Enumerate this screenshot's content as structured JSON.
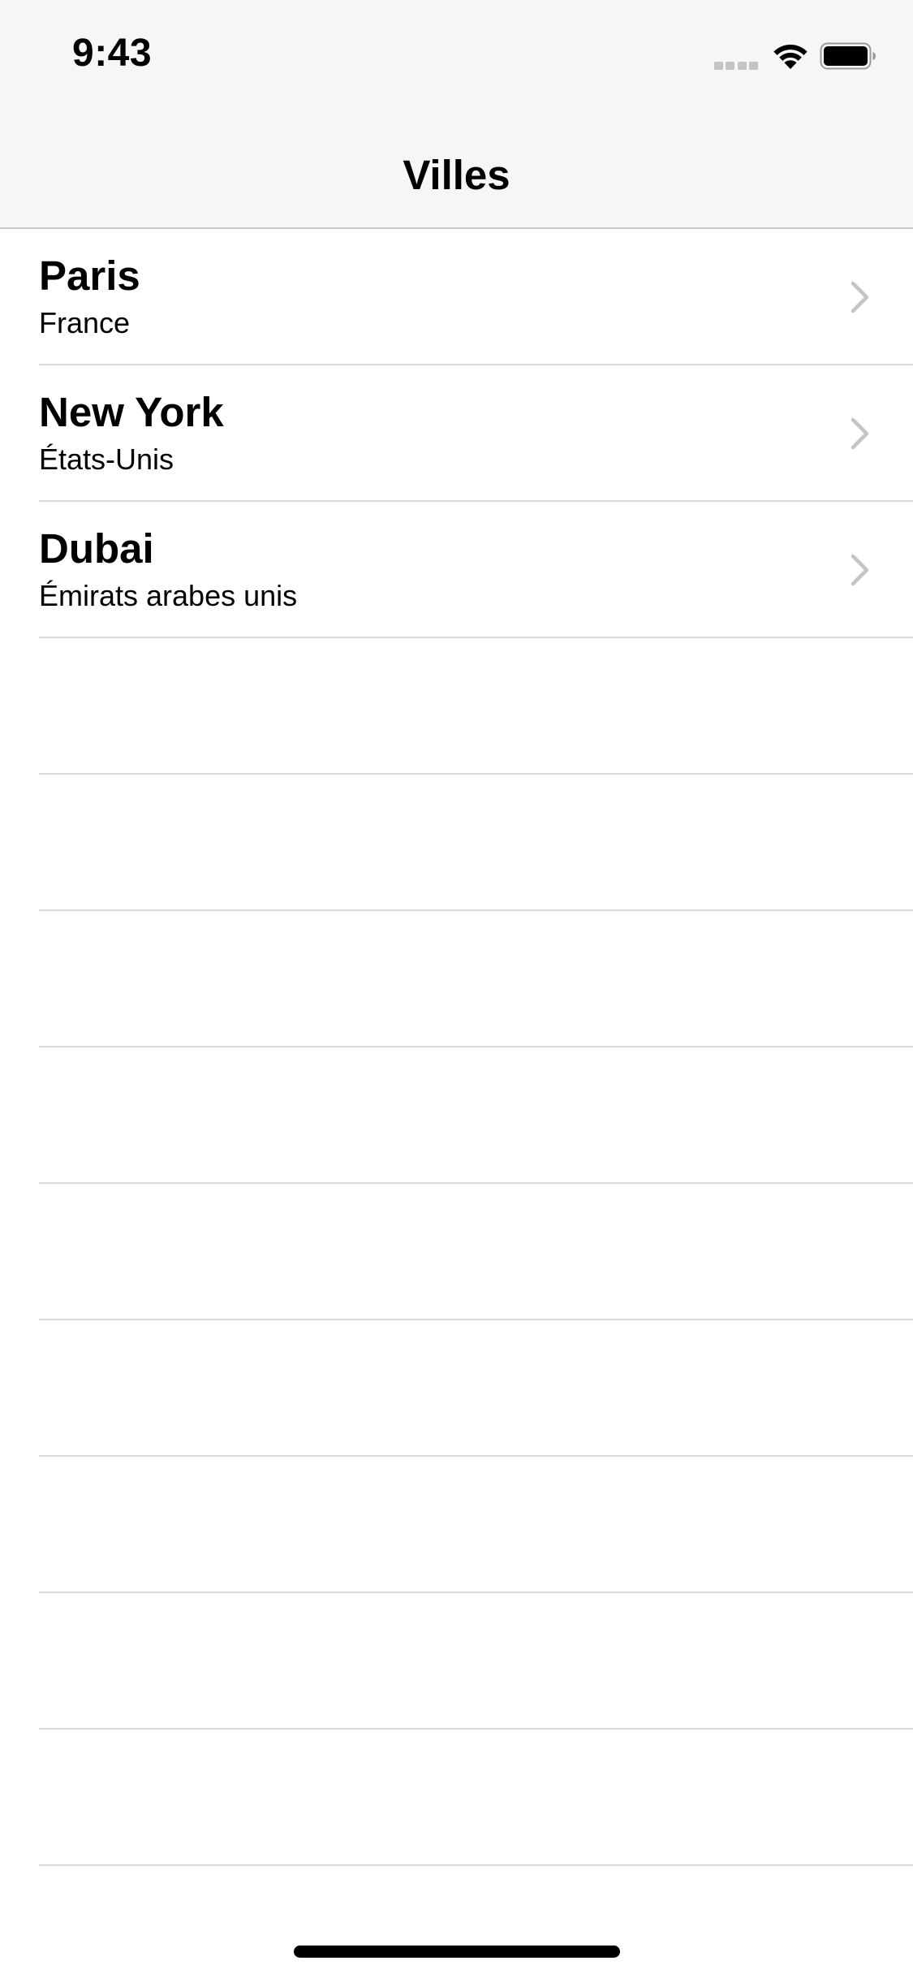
{
  "status_bar": {
    "time": "9:43"
  },
  "navigation": {
    "title": "Villes"
  },
  "cities": [
    {
      "name": "Paris",
      "country": "France"
    },
    {
      "name": "New York",
      "country": "États-Unis"
    },
    {
      "name": "Dubai",
      "country": "Émirats arabes unis"
    }
  ],
  "empty_rows": 9,
  "colors": {
    "nav_background": "#f6f6f6",
    "separator": "#dadada",
    "chevron": "#c4c4c9",
    "text": "#000000"
  }
}
